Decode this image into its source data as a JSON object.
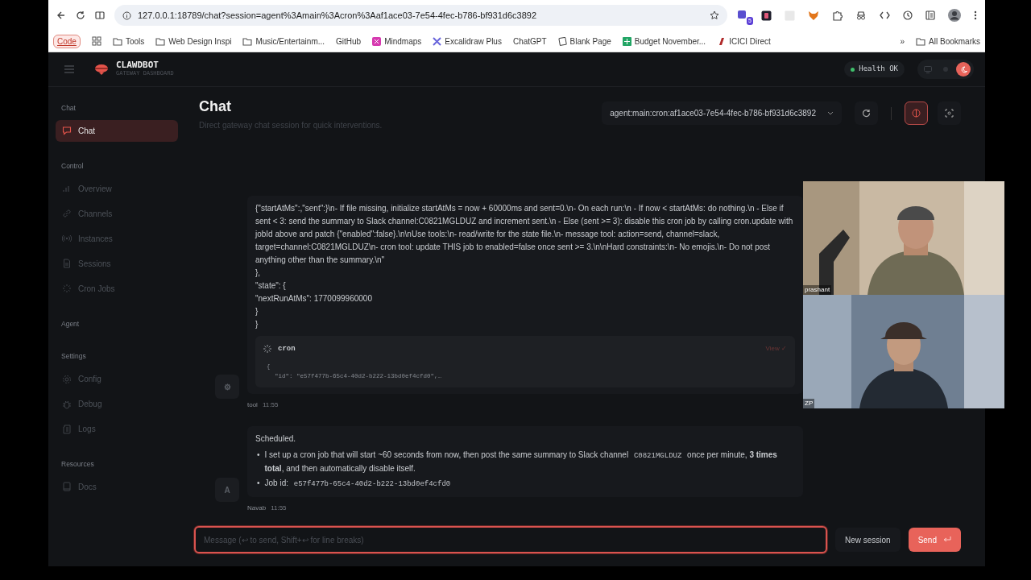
{
  "browser": {
    "url": "127.0.0.1:18789/chat?session=agent%3Amain%3Acron%3Aaf1ace03-7e54-4fec-b786-bf931d6c3892",
    "extension_badge": "5",
    "bookmarks": [
      {
        "kind": "chip",
        "label": "Code"
      },
      {
        "kind": "apps"
      },
      {
        "kind": "folder",
        "label": "Tools"
      },
      {
        "kind": "folder",
        "label": "Web Design Inspi"
      },
      {
        "kind": "folder",
        "label": "Music/Entertainm..."
      },
      {
        "kind": "link",
        "label": "GitHub"
      },
      {
        "kind": "mindmap",
        "label": "Mindmaps"
      },
      {
        "kind": "excalidraw",
        "label": "Excalidraw Plus"
      },
      {
        "kind": "link",
        "label": "ChatGPT"
      },
      {
        "kind": "page",
        "label": "Blank Page"
      },
      {
        "kind": "sheet",
        "label": "Budget November..."
      },
      {
        "kind": "bank",
        "label": "ICICI Direct"
      }
    ],
    "more": "»",
    "all_bookmarks": "All Bookmarks"
  },
  "app": {
    "brand": "CLAWDBOT",
    "tagline": "GATEWAY DASHBOARD",
    "health": "Health OK"
  },
  "sidebar": [
    {
      "title": "Chat",
      "items": [
        {
          "label": "Chat",
          "selected": true
        }
      ]
    },
    {
      "title": "Control",
      "items": [
        {
          "label": "Overview",
          "selected": false
        },
        {
          "label": "Channels",
          "selected": false
        },
        {
          "label": "Instances",
          "selected": false
        },
        {
          "label": "Sessions",
          "selected": false
        },
        {
          "label": "Cron Jobs",
          "selected": false
        }
      ]
    },
    {
      "title": "Agent"
    },
    {
      "title": "Settings",
      "items": [
        {
          "label": "Config",
          "selected": false
        },
        {
          "label": "Debug",
          "selected": false
        },
        {
          "label": "Logs",
          "selected": false
        }
      ]
    },
    {
      "title": "Resources",
      "items": [
        {
          "label": "Docs",
          "selected": false
        }
      ]
    }
  ],
  "page": {
    "title": "Chat",
    "subtitle": "Direct gateway chat session for quick interventions.",
    "session": "agent:main:cron:af1ace03-7e54-4fec-b786-bf931d6c3892"
  },
  "messages": [
    {
      "kind": "tool",
      "avatar": "⚙",
      "author": "tool",
      "time": "11:55",
      "lines": [
        "{\"startAtMs\":,\"sent\":}\\n- If file missing, initialize startAtMs = now + 60000ms and sent=0.\\n- On each run:\\n - If now < startAtMs: do nothing.\\n - Else if sent < 3: send the summary to Slack channel:C0821MGLDUZ and increment sent.\\n - Else (sent >= 3): disable this cron job by calling cron.update with jobId above and patch {\"enabled\":false}.\\n\\nUse tools:\\n- read/write for the state file.\\n- message tool: action=send, channel=slack, target=channel:C0821MGLDUZ\\n- cron tool: update THIS job to enabled=false once sent >= 3.\\n\\nHard constraints:\\n- No emojis.\\n- Do not post anything other than the summary.\\n\"",
        "},",
        "\"state\": {",
        "\"nextRunAtMs\": 1770099960000",
        "}",
        "}"
      ],
      "tool_card": {
        "name": "cron",
        "action": "View ✓",
        "code": [
          "{",
          "\"id\": \"e57f477b-65c4-40d2-b222-13bd0ef4cfd0\",…"
        ]
      }
    },
    {
      "kind": "assistant",
      "avatar": "A",
      "author": "Navab",
      "time": "11:55",
      "heading": "Scheduled.",
      "bullets": [
        {
          "marker": "•",
          "segments": [
            {
              "kind": "text",
              "text": "I set up a cron job that will start ~60 seconds from now, then post the same summary to Slack channel"
            },
            {
              "kind": "code",
              "text": "C0821MGLDUZ"
            },
            {
              "kind": "text",
              "text": "once per minute, **3 times total**, and then automatically disable itself."
            }
          ]
        },
        {
          "marker": "•",
          "segments": [
            {
              "kind": "text",
              "text": "Job id:"
            },
            {
              "kind": "code",
              "text": "e57f477b-65c4-40d2-b222-13bd0ef4cfd0"
            }
          ]
        }
      ]
    }
  ],
  "composer": {
    "placeholder": "Message (↩ to send, Shift+↩ for line breaks)",
    "new_session": "New session",
    "send": "Send"
  },
  "video_tiles": [
    {
      "kind": "picture",
      "name": "prashant"
    },
    {
      "kind": "picture",
      "name": "ZP"
    }
  ]
}
